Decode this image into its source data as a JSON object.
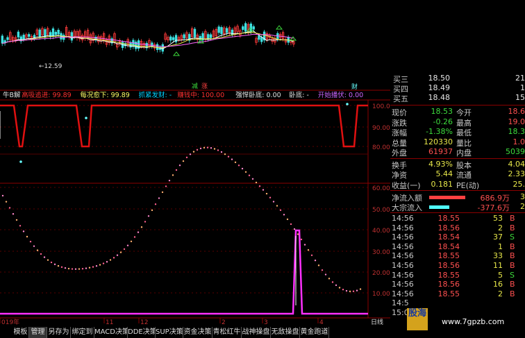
{
  "kline": {
    "low_label": "12.59",
    "markers": [
      "减",
      "涨"
    ],
    "right_tag": "财"
  },
  "indicator_bar": {
    "items": [
      {
        "text": "牛B解",
        "color": "#e0e0e0"
      },
      {
        "text": "高吸追进: 99.89",
        "color": "#ff3030"
      },
      {
        "text": "每况愈下: 99.89",
        "color": "#ffff66"
      },
      {
        "text": "抓紧发财: -",
        "color": "#00d0ff"
      },
      {
        "text": "赚钱中: 100.00",
        "color": "#ff3030"
      },
      {
        "text": "强悍卧底: 0.00",
        "color": "#e0e0e0"
      },
      {
        "text": "卧底: -",
        "color": "#e0e0e0"
      },
      {
        "text": "开始播伏: 0.00",
        "color": "#cc66ff"
      }
    ]
  },
  "axes": {
    "upper_ticks": [
      "100.00",
      "90.00",
      "80.00"
    ],
    "lower_ticks": [
      "60.00",
      "50.00",
      "40.00",
      "30.00",
      "20.00",
      "10.00"
    ],
    "time_labels": [
      "019年",
      "11",
      "12",
      "2",
      "3",
      "4"
    ],
    "period_label": "日线"
  },
  "tabs": [
    "模板",
    "管理",
    "另存为",
    "绑定到",
    "MACD决策",
    "DDE决策",
    "SUP决策",
    "资金决策",
    "青松红牛",
    "战神操盘",
    "无敌操盘",
    "黄金跑道"
  ],
  "quote": {
    "asks": [
      {
        "label": "买三",
        "price": "18.50",
        "vol": "21"
      },
      {
        "label": "买四",
        "price": "18.49",
        "vol": "1"
      },
      {
        "label": "买五",
        "price": "18.48",
        "vol": "15"
      }
    ],
    "stats": [
      {
        "l1": "现价",
        "v1": "18.53",
        "c1": "green",
        "l2": "今开",
        "v2": "18.6",
        "c2": "red"
      },
      {
        "l1": "涨跌",
        "v1": "-0.26",
        "c1": "green",
        "l2": "最高",
        "v2": "19.0",
        "c2": "red"
      },
      {
        "l1": "涨幅",
        "v1": "-1.38%",
        "c1": "green",
        "l2": "最低",
        "v2": "18.3",
        "c2": "green"
      },
      {
        "l1": "总量",
        "v1": "120330",
        "c1": "yellow",
        "l2": "量比",
        "v2": "1.0",
        "c2": "red"
      },
      {
        "l1": "外盘",
        "v1": "61937",
        "c1": "red",
        "l2": "内盘",
        "v2": "5039",
        "c2": "green"
      }
    ],
    "stats2": [
      {
        "l1": "换手",
        "v1": "4.93%",
        "c1": "yellow",
        "l2": "股本",
        "v2": "4.04",
        "c2": "yellow"
      },
      {
        "l1": "净资",
        "v1": "5.44",
        "c1": "yellow",
        "l2": "流通",
        "v2": "2.33",
        "c2": "yellow"
      },
      {
        "l1": "收益(一)",
        "v1": "0.181",
        "c1": "yellow",
        "l2": "PE(动)",
        "v2": "25.",
        "c2": "yellow"
      }
    ],
    "flow": [
      {
        "label": "净流入额",
        "value": "686.9万",
        "extra": "3",
        "bar_color": "#ff4040",
        "bar_ratio": 1.0
      },
      {
        "label": "大宗流入",
        "value": "-377.6万",
        "extra": "2",
        "bar_color": "#50ffff",
        "bar_ratio": 0.55
      }
    ],
    "ticks": [
      {
        "time": "14:56",
        "price": "18.55",
        "pc": "red",
        "vol": "53",
        "dir": "B",
        "dc": "red"
      },
      {
        "time": "14:56",
        "price": "18.56",
        "pc": "red",
        "vol": "2",
        "dir": "B",
        "dc": "red"
      },
      {
        "time": "14:56",
        "price": "18.54",
        "pc": "red",
        "vol": "37",
        "dir": "S",
        "dc": "green"
      },
      {
        "time": "14:56",
        "price": "18.54",
        "pc": "red",
        "vol": "1",
        "dir": "B",
        "dc": "red"
      },
      {
        "time": "14:56",
        "price": "18.55",
        "pc": "red",
        "vol": "33",
        "dir": "B",
        "dc": "red"
      },
      {
        "time": "14:56",
        "price": "18.56",
        "pc": "red",
        "vol": "11",
        "dir": "B",
        "dc": "red"
      },
      {
        "time": "14:56",
        "price": "18.55",
        "pc": "red",
        "vol": "5",
        "dir": "S",
        "dc": "green"
      },
      {
        "time": "14:56",
        "price": "18.56",
        "pc": "red",
        "vol": "16",
        "dir": "B",
        "dc": "red"
      },
      {
        "time": "14:56",
        "price": "18.55",
        "pc": "red",
        "vol": "2",
        "dir": "B",
        "dc": "red"
      },
      {
        "time": "14:5",
        "price": "",
        "pc": "red",
        "vol": "",
        "dir": "",
        "dc": "red"
      },
      {
        "time": "15:0",
        "price": "",
        "pc": "red",
        "vol": "",
        "dir": "",
        "dc": "red"
      }
    ]
  },
  "watermark": {
    "brand": "股海",
    "url": "www.7gpzb.com"
  }
}
